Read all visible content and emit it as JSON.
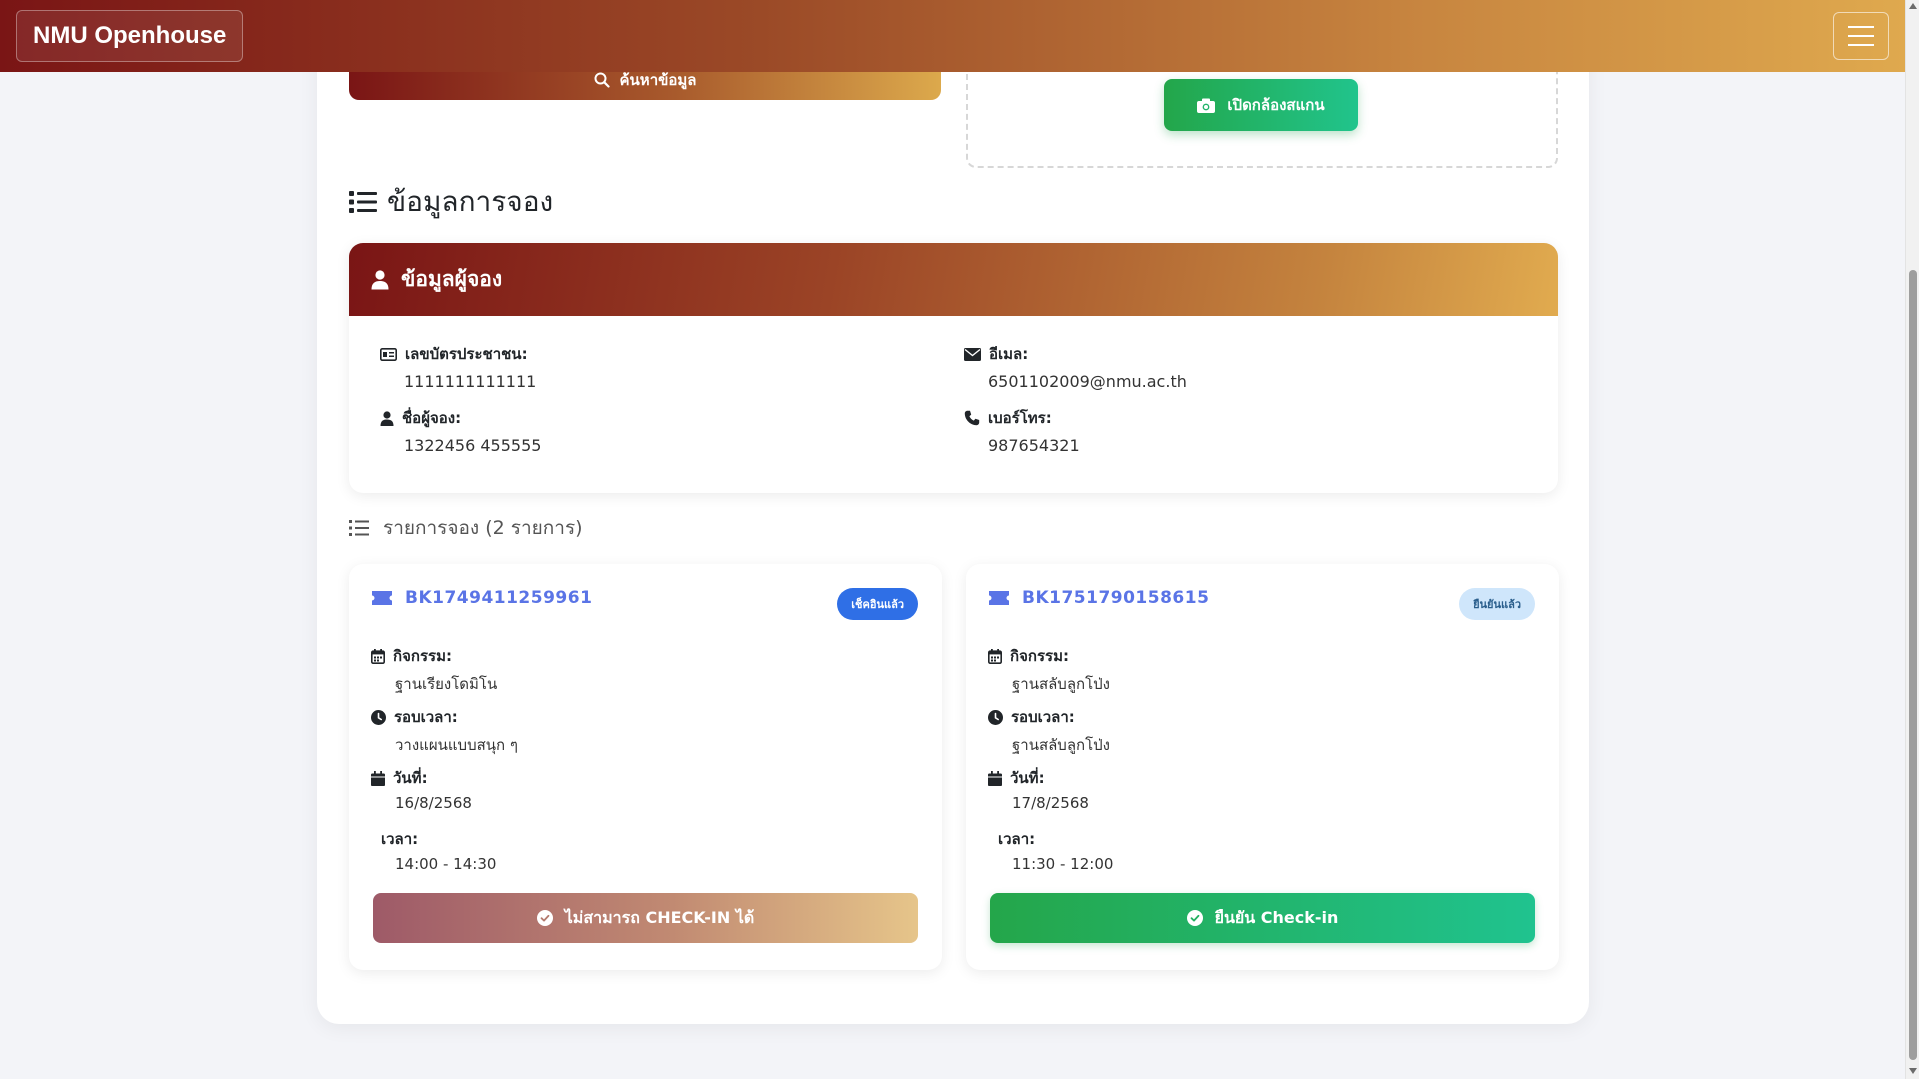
{
  "navbar": {
    "brand": "NMU Openhouse",
    "menu_icon": "hamburger-icon"
  },
  "search": {
    "button_label": "ค้นหาข้อมูล",
    "icon": "search-icon"
  },
  "scanner": {
    "button_label": "เปิดกล้องสแกน",
    "icon": "camera-icon"
  },
  "section": {
    "title": "ข้อมูลการจอง",
    "icon": "list-icon"
  },
  "booker": {
    "header": "ข้อมูลผู้จอง",
    "id_card_label": "เลขบัตรประชาชน:",
    "id_card_value": "1111111111111",
    "name_label": "ชื่อผู้จอง:",
    "name_value": "1322456 455555",
    "email_label": "อีเมล:",
    "email_value": "6501102009@nmu.ac.th",
    "phone_label": "เบอร์โทร:",
    "phone_value": "987654321"
  },
  "bookings_title": "รายการจอง (2 รายการ)",
  "bookings": [
    {
      "code": "BK1749411259961",
      "status": "เช็คอินแล้ว",
      "activity_label": "กิจกรรม:",
      "activity": "ฐานเรียงโดมิโน",
      "round_label": "รอบเวลา:",
      "round": "วางแผนแบบสนุก ๆ",
      "date_label": "วันที่:",
      "date": "16/8/2568",
      "time_label": "เวลา:",
      "time": "14:00 - 14:30",
      "action_label": "ไม่สามารถ CHECK-IN ได้"
    },
    {
      "code": "BK1751790158615",
      "status": "ยืนยันแล้ว",
      "activity_label": "กิจกรรม:",
      "activity": "ฐานสลับลูกโป่ง",
      "round_label": "รอบเวลา:",
      "round": "ฐานสลับลูกโป่ง",
      "date_label": "วันที่:",
      "date": "17/8/2568",
      "time_label": "เวลา:",
      "time": "11:30 - 12:00",
      "action_label": "ยืนยัน Check-in"
    }
  ],
  "colors": {
    "brand_start": "#7a1515",
    "brand_end": "#dfa94e",
    "accent_blue": "#5a74e6",
    "success": "#24a64a",
    "badge_checked_in": "#2f6fe6",
    "badge_confirmed": "#cfe6fb"
  }
}
